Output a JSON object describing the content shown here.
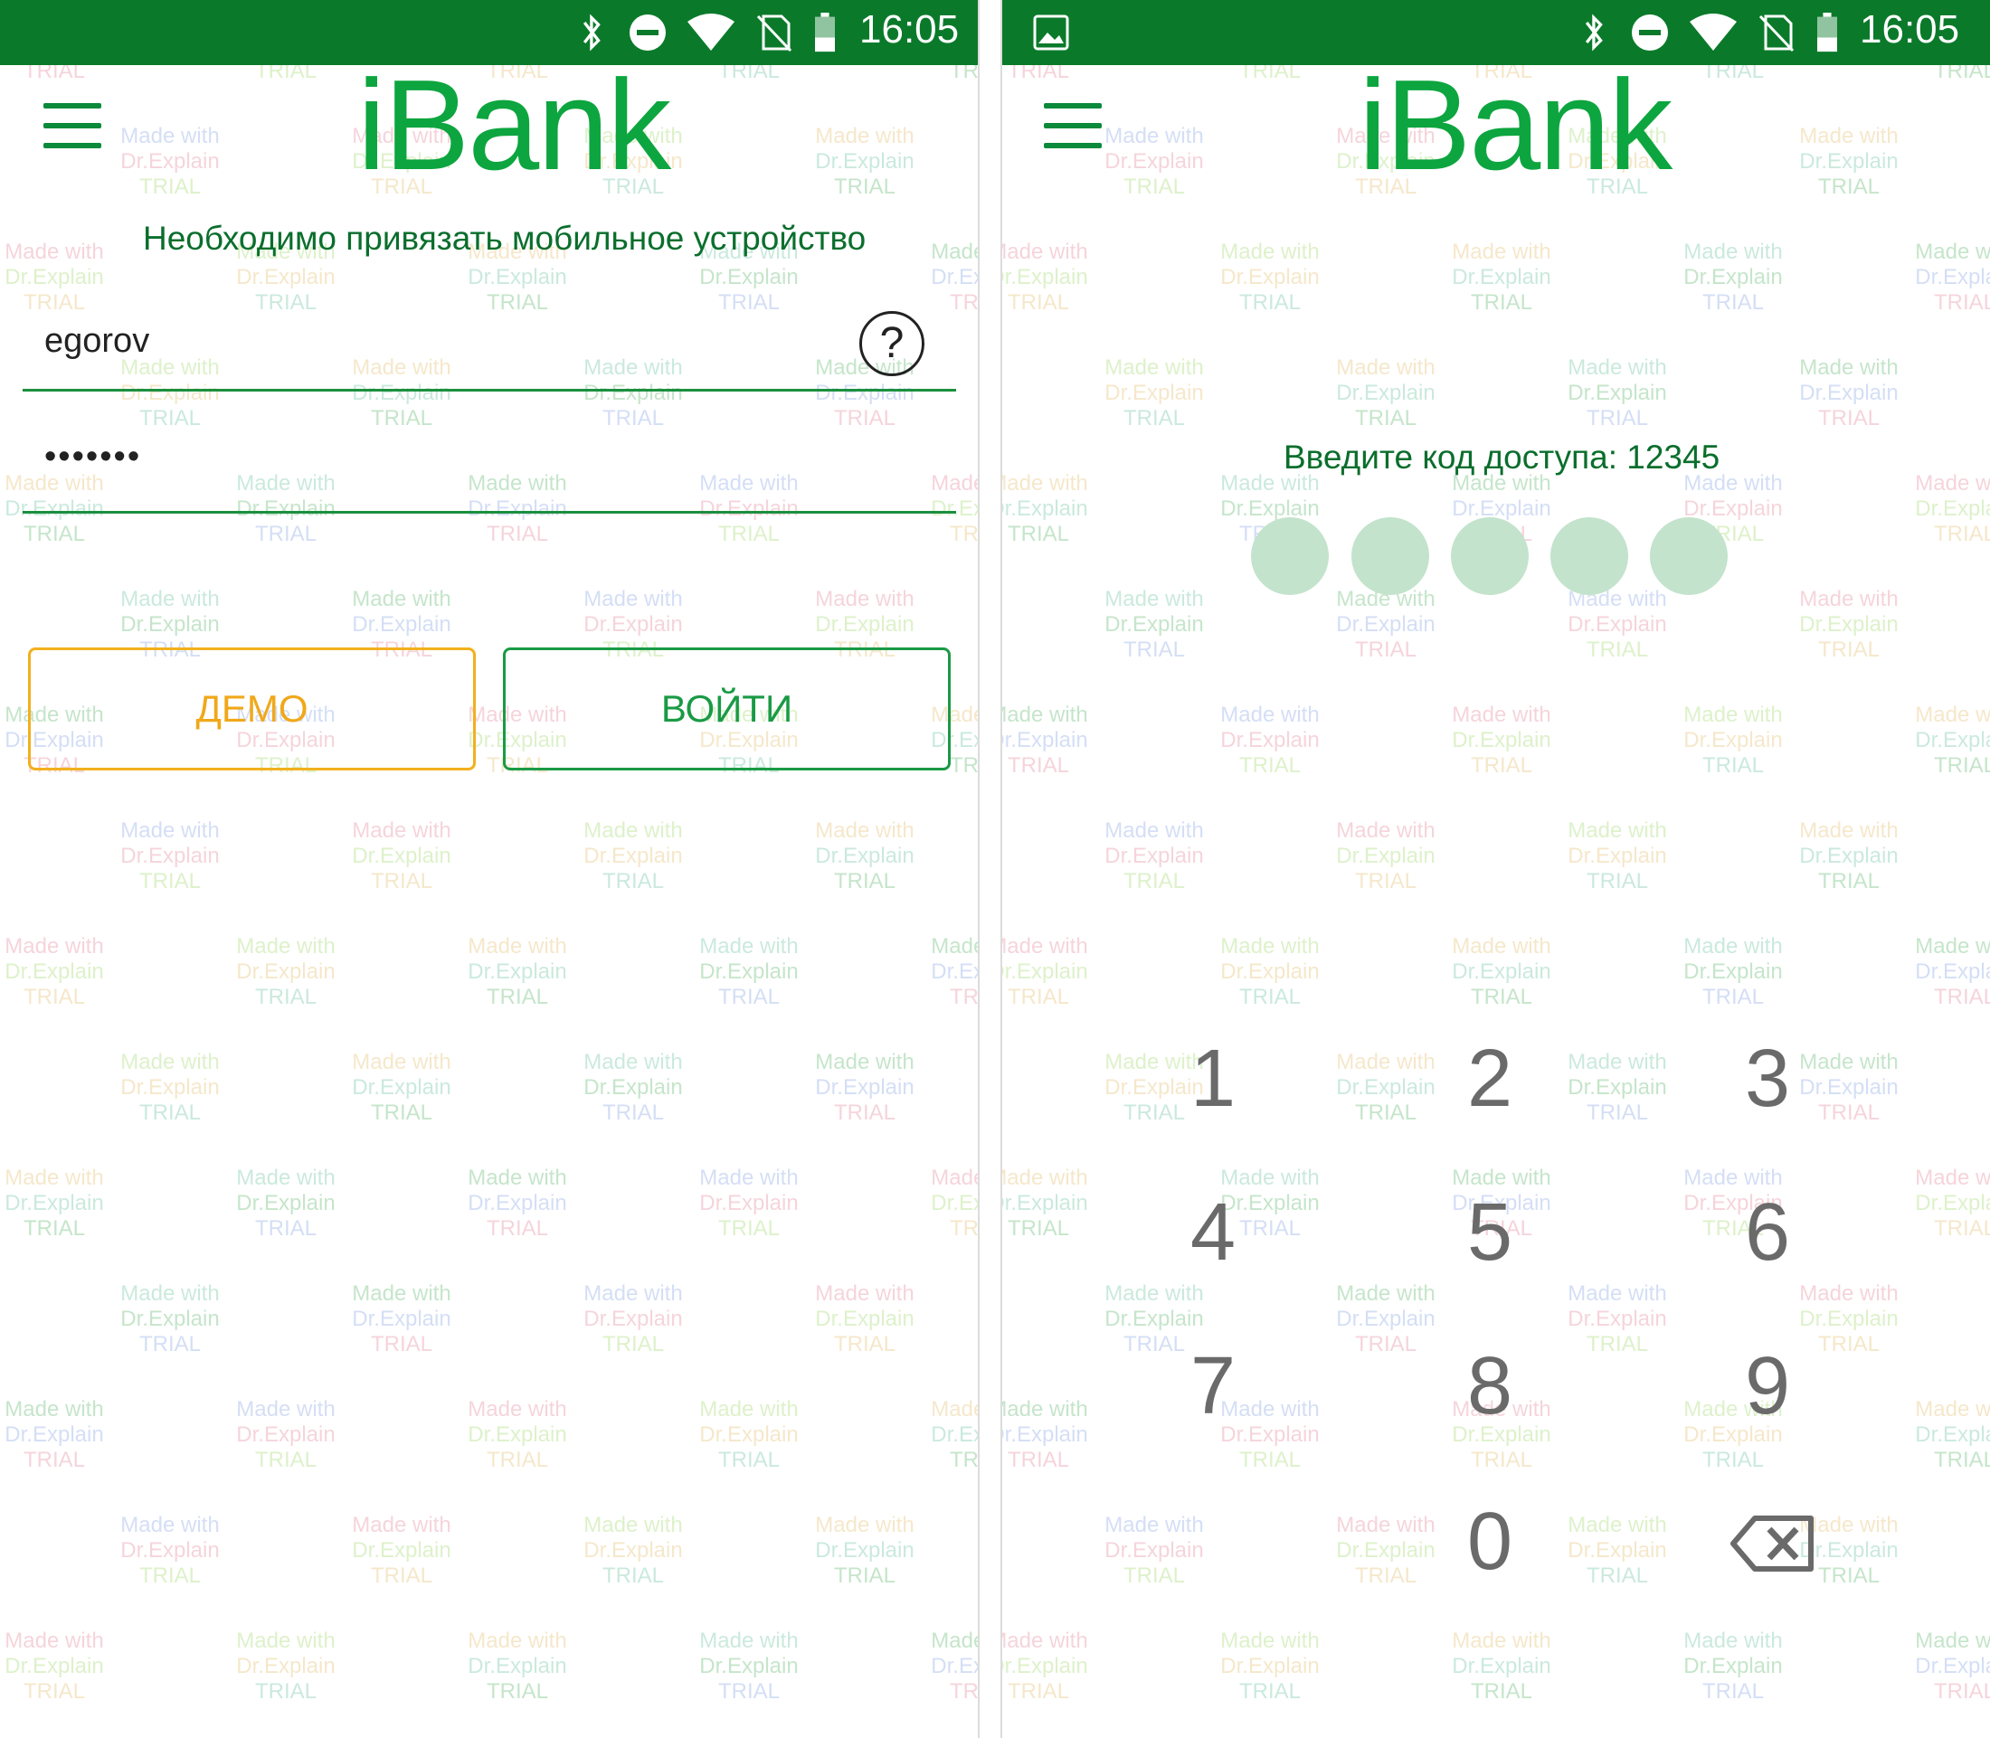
{
  "watermark": {
    "lines": [
      "Made with",
      "Dr.Explain",
      "TRIAL"
    ]
  },
  "left_screen": {
    "status_bar": {
      "time": "16:05",
      "icons": [
        "bluetooth-icon",
        "do-not-disturb-icon",
        "wifi-icon",
        "no-sim-icon",
        "battery-icon"
      ]
    },
    "app_bar": {
      "menu_icon": "hamburger-menu-icon",
      "title": "iBank"
    },
    "message": "Необходимо привязать мобильное устройство",
    "login_field": {
      "value": "egorov"
    },
    "password_field": {
      "value": "•••••••"
    },
    "help_icon": "?",
    "buttons": {
      "demo": "ДЕМО",
      "login": "ВОЙТИ"
    },
    "colors": {
      "status_bar": "#0a7a2a",
      "brand": "#0da53f",
      "demo": "#f0a81a",
      "login": "#1a9a45"
    }
  },
  "right_screen": {
    "status_bar": {
      "time": "16:05",
      "icons": [
        "image-icon",
        "bluetooth-icon",
        "do-not-disturb-icon",
        "wifi-icon",
        "no-sim-icon",
        "battery-icon"
      ]
    },
    "app_bar": {
      "menu_icon": "hamburger-menu-icon",
      "title": "iBank"
    },
    "prompt": "Введите код доступа: 12345",
    "pin_entered": 0,
    "pin_length": 5,
    "keypad": {
      "keys": [
        "1",
        "2",
        "3",
        "4",
        "5",
        "6",
        "7",
        "8",
        "9",
        "0"
      ],
      "backspace_icon": "backspace-icon"
    },
    "colors": {
      "dot": "#c3e3cc"
    }
  }
}
